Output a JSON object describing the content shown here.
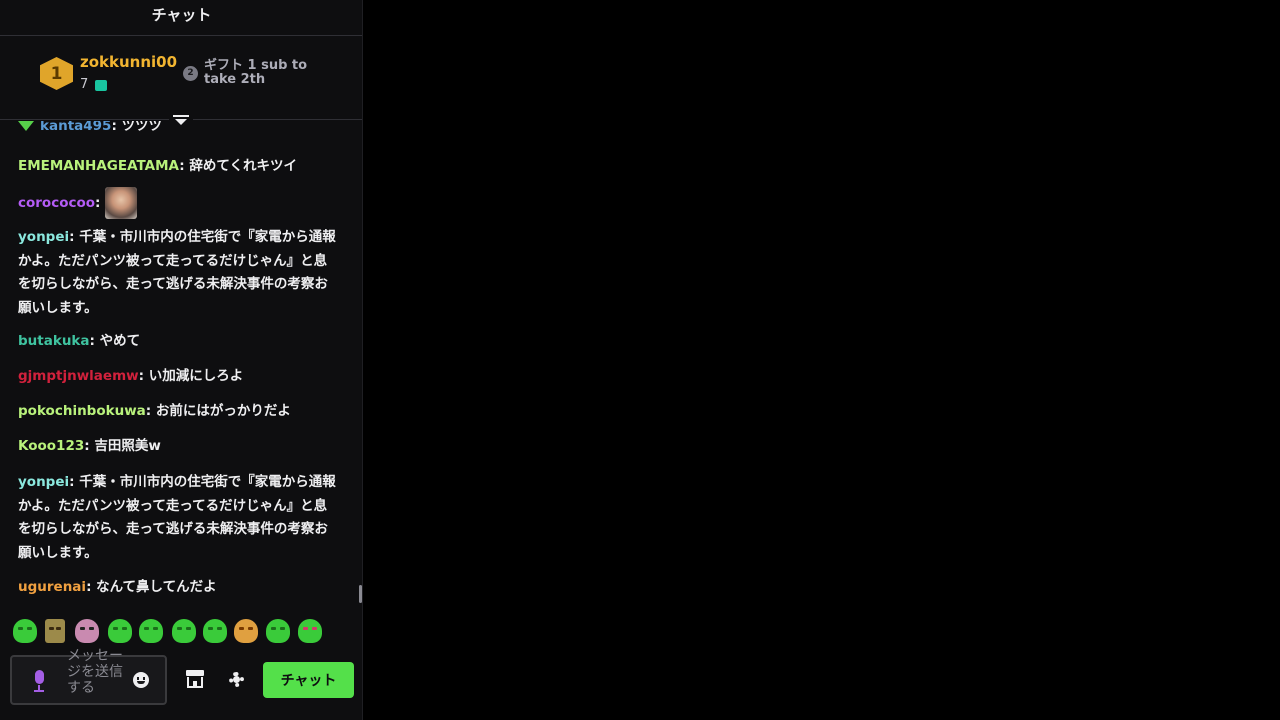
{
  "header": {
    "title": "チャット"
  },
  "leaderboard": {
    "rank1_badge": "1",
    "rank1_user": "zokkunni00",
    "rank1_count": "7",
    "rank2_badge": "2",
    "gift_prompt_line1": "ギフト 1 sub to",
    "gift_prompt_line2": "take 2th"
  },
  "messages": [
    {
      "user": "kanta495",
      "user_color": "#5b9bd5",
      "text": "ツツツ",
      "partial": true
    },
    {
      "user": "EMEMANHAGEATAMA",
      "user_color": "#b9f27c",
      "text": "辞めてくれキツイ"
    },
    {
      "user": "corococoo",
      "user_color": "#b45cf5",
      "text": "",
      "emote": "face-emote"
    },
    {
      "user": "yonpei",
      "user_color": "#8be8de",
      "text": "千葉・市川市内の住宅街で『家電から通報かよ。ただパンツ被って走ってるだけじゃん』と息を切らしながら、走って逃げる未解決事件の考察お願いします。"
    },
    {
      "user": "butakuka",
      "user_color": "#3fc3a0",
      "text": "やめて"
    },
    {
      "user": "gjmptjnwlaemw",
      "user_color": "#d1213c",
      "text": "い加減にしろよ"
    },
    {
      "user": "pokochinbokuwa",
      "user_color": "#b9f27c",
      "text": "お前にはがっかりだよ"
    },
    {
      "user": "Kooo123",
      "user_color": "#b9f27c",
      "text": "吉田照美w"
    },
    {
      "user": "yonpei",
      "user_color": "#8be8de",
      "text": "千葉・市川市内の住宅街で『家電から通報かよ。ただパンツ被って走ってるだけじゃん』と息を切らしながら、走って逃げる未解決事件の考察お願いします。"
    },
    {
      "user": "ugurenai",
      "user_color": "#f0a040",
      "text": "なんて鼻してんだよ"
    }
  ],
  "separator": ": ",
  "composer": {
    "placeholder": "メッセージを送信する",
    "send_label": "チャット"
  },
  "icons": {
    "collapse": "collapse-leaderboard-icon",
    "mic": "microphone-icon",
    "emoji": "emoji-icon",
    "store": "store-icon",
    "settings": "gear-icon"
  },
  "colors": {
    "background": "#0e0e10",
    "accent_button": "#54e04a",
    "rank1_gold": "#f2b531",
    "mic_purple": "#a45ee5"
  }
}
